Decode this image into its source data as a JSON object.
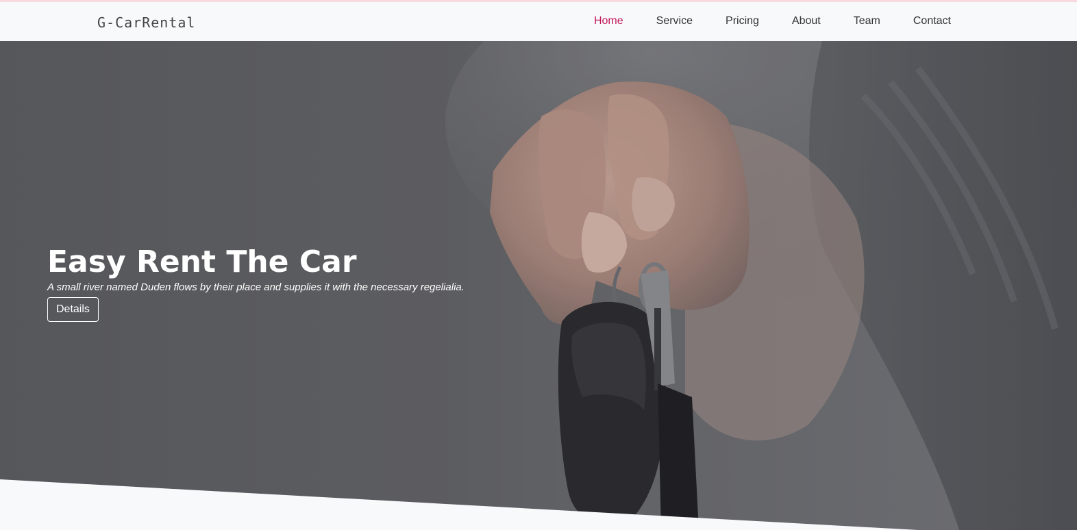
{
  "brand": {
    "name": "G-CarRental"
  },
  "nav": {
    "items": [
      {
        "label": "Home",
        "active": true
      },
      {
        "label": "Service",
        "active": false
      },
      {
        "label": "Pricing",
        "active": false
      },
      {
        "label": "About",
        "active": false
      },
      {
        "label": "Team",
        "active": false
      },
      {
        "label": "Contact",
        "active": false
      }
    ]
  },
  "hero": {
    "title": "Easy Rent The Car",
    "subtitle": "A small river named Duden flows by their place and supplies it with the necessary regelialia.",
    "button_label": "Details",
    "image": "hand-holding-car-key"
  },
  "colors": {
    "accent": "#c2185b",
    "navbar_bg": "#f8f9fa",
    "top_line": "#f7d9df",
    "hero_text": "#ffffff"
  }
}
